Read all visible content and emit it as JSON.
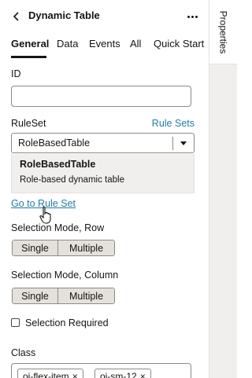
{
  "header": {
    "title": "Dynamic Table",
    "back_icon": "chevron-left-icon",
    "more_icon": "more-horizontal-icon"
  },
  "tabs": [
    {
      "label": "General",
      "active": true
    },
    {
      "label": "Data",
      "active": false
    },
    {
      "label": "Events",
      "active": false
    },
    {
      "label": "All",
      "active": false
    },
    {
      "label": "Quick Start",
      "active": false
    }
  ],
  "side_tab": {
    "label": "Properties"
  },
  "id_field": {
    "label": "ID",
    "value": ""
  },
  "ruleset": {
    "label": "RuleSet",
    "link": "Rule Sets",
    "value": "RoleBasedTable",
    "option_title": "RoleBasedTable",
    "option_description": "Role-based dynamic table"
  },
  "goto_link": "Go to Rule Set",
  "selection_row": {
    "label": "Selection Mode, Row",
    "options": [
      "Single",
      "Multiple"
    ]
  },
  "selection_column": {
    "label": "Selection Mode, Column",
    "options": [
      "Single",
      "Multiple"
    ]
  },
  "selection_required": {
    "label": "Selection Required",
    "checked": false
  },
  "class_field": {
    "label": "Class",
    "chips": [
      "oj-flex-item",
      "oj-sm-12"
    ]
  },
  "colors": {
    "accent": "#227e9e",
    "text": "#161513",
    "segment_bg": "#e4e1dd"
  }
}
